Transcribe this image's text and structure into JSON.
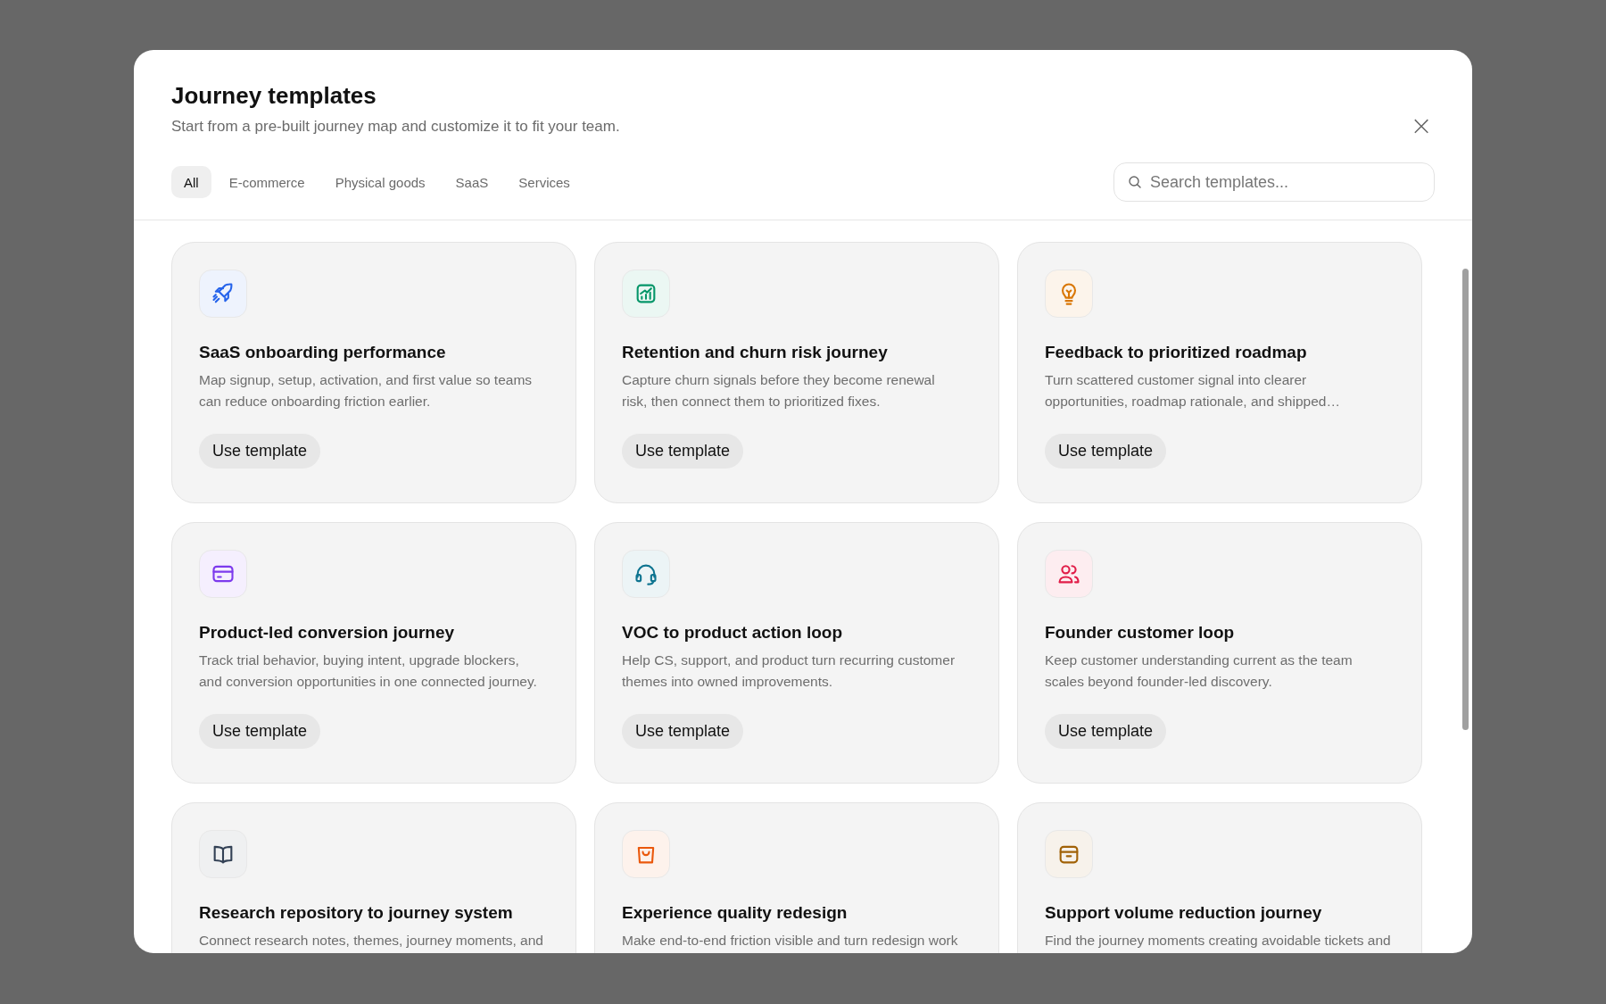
{
  "dialog": {
    "title": "Journey templates",
    "subtitle": "Start from a pre-built journey map and customize it to fit your team.",
    "close": "×"
  },
  "tabs": [
    {
      "label": "All",
      "selected": true
    },
    {
      "label": "E-commerce",
      "selected": false
    },
    {
      "label": "Physical goods",
      "selected": false
    },
    {
      "label": "SaaS",
      "selected": false
    },
    {
      "label": "Services",
      "selected": false
    }
  ],
  "search": {
    "placeholder": "Search templates..."
  },
  "templates": [
    {
      "kind": "rocket",
      "color": "#2563eb",
      "title": "SaaS onboarding performance",
      "description": "Map signup, setup, activation, and first value so teams can reduce onboarding friction earlier.",
      "button": "Use template"
    },
    {
      "kind": "chart",
      "color": "#059669",
      "title": "Retention and churn risk journey",
      "description": "Capture churn signals before they become renewal risk, then connect them to prioritized fixes.",
      "button": "Use template"
    },
    {
      "kind": "bulb",
      "color": "#d97706",
      "title": "Feedback to prioritized roadmap",
      "description": "Turn scattered customer signal into clearer opportunities, roadmap rationale, and shipped…",
      "button": "Use template"
    },
    {
      "kind": "card",
      "color": "#7c3aed",
      "title": "Product-led conversion journey",
      "description": "Track trial behavior, buying intent, upgrade blockers, and conversion opportunities in one connected journey.",
      "button": "Use template"
    },
    {
      "kind": "headset",
      "color": "#0e7490",
      "title": "VOC to product action loop",
      "description": "Help CS, support, and product turn recurring customer themes into owned improvements.",
      "button": "Use template"
    },
    {
      "kind": "users",
      "color": "#e11d48",
      "title": "Founder customer loop",
      "description": "Keep customer understanding current as the team scales beyond founder-led discovery.",
      "button": "Use template"
    },
    {
      "kind": "book",
      "color": "#334155",
      "title": "Research repository to journey system",
      "description": "Connect research notes, themes, journey moments, and"
    },
    {
      "kind": "bag",
      "color": "#ea580c",
      "title": "Experience quality redesign",
      "description": "Make end-to-end friction visible and turn redesign work"
    },
    {
      "kind": "box",
      "color": "#a16207",
      "title": "Support volume reduction journey",
      "description": "Find the journey moments creating avoidable tickets and"
    }
  ]
}
